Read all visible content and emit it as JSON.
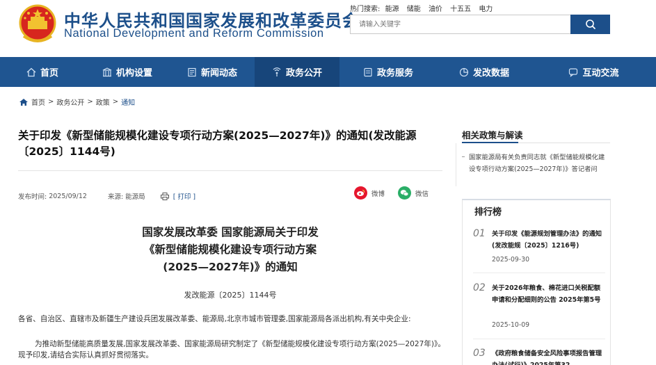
{
  "header": {
    "logo_cn": "中华人民共和国国家发展和改革委员会",
    "logo_en": "National Development and Reform Commission",
    "hot_label": "热门搜索:",
    "hot_terms": [
      "能源",
      "储能",
      "油价",
      "十五五",
      "电力"
    ],
    "search_placeholder": "请输入关键字"
  },
  "nav": {
    "items": [
      {
        "label": "首页",
        "icon": "home-icon"
      },
      {
        "label": "机构设置",
        "icon": "building-icon"
      },
      {
        "label": "新闻动态",
        "icon": "news-icon"
      },
      {
        "label": "政务公开",
        "icon": "broadcast-icon",
        "active": true
      },
      {
        "label": "政务服务",
        "icon": "service-icon"
      },
      {
        "label": "发改数据",
        "icon": "pie-chart-icon"
      },
      {
        "label": "互动交流",
        "icon": "chat-icon"
      }
    ]
  },
  "breadcrumb": {
    "items": [
      "首页",
      "政务公开",
      "政策"
    ],
    "current": "通知",
    "sep": ">"
  },
  "article": {
    "title": "关于印发《新型储能规模化建设专项行动方案(2025—2027年)》的通知(发改能源〔2025〕1144号)",
    "publish_label": "发布时间:",
    "publish_date": "2025/09/12",
    "source_label": "来源:",
    "source": "能源局",
    "print": "[ 打印 ]",
    "share_weibo": "微博",
    "share_wechat": "微信",
    "doc_heading_1": "国家发展改革委 国家能源局关于印发",
    "doc_heading_2": "《新型储能规模化建设专项行动方案",
    "doc_heading_3": "(2025—2027年)》的通知",
    "doc_number": "发改能源〔2025〕1144号",
    "body_p1": "各省、自治区、直辖市及新疆生产建设兵团发展改革委、能源局,北京市城市管理委,国家能源局各派出机构,有关中央企业:",
    "body_p2": "为推动新型储能高质量发展,国家发展改革委、国家能源局研究制定了《新型储能规模化建设专项行动方案(2025—2027年)》。现予印发,请结合实际认真抓好贯彻落实。"
  },
  "sidebar": {
    "related_title": "相关政策与解读",
    "related_items": [
      "国家能源局有关负责同志就《新型储能规模化建设专项行动方案(2025—2027年)》答记者问"
    ],
    "rank_title": "排行榜",
    "rank_items": [
      {
        "num": "01",
        "title": "关于印发《能源规划管理办法》的通知(发改能规〔2025〕1216号)",
        "date": "2025-09-30"
      },
      {
        "num": "02",
        "title": "关于2026年粮食、棉花进口关税配额申请和分配细则的公告 2025年第5号",
        "date": "2025-10-09"
      },
      {
        "num": "03",
        "title": "《政府粮食储备安全风险事项报告管理办法(试行)》2025年第32",
        "date": ""
      }
    ]
  },
  "colors": {
    "brand_blue": "#1c4f8a",
    "nav_bg": "#1f5591",
    "nav_active": "#17457a",
    "weibo_red": "#e6162d",
    "wechat_green": "#2aae67"
  }
}
